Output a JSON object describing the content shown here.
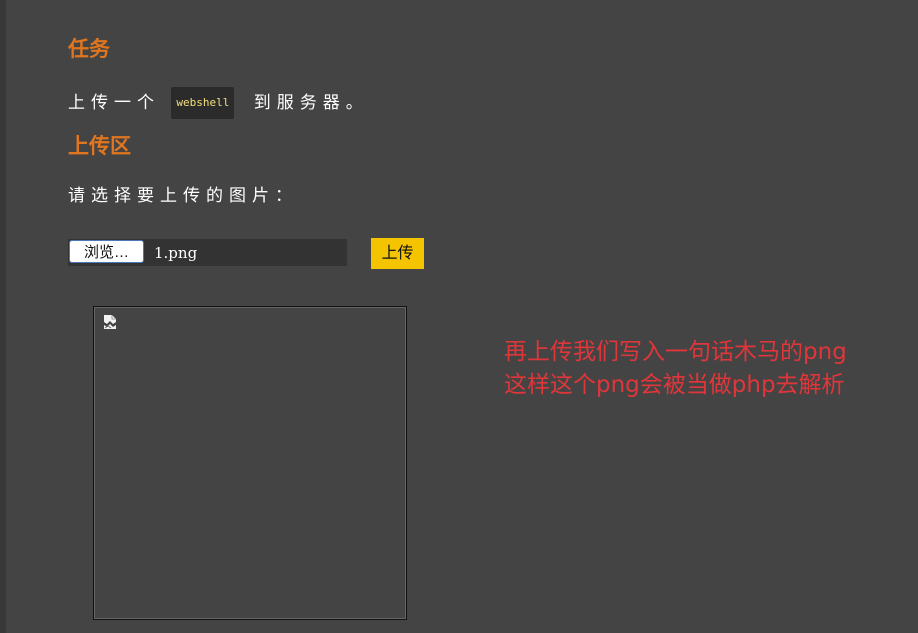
{
  "task": {
    "title": "任务",
    "text_before": "上传一个",
    "code": "webshell",
    "text_after": "到服务器。"
  },
  "upload": {
    "title": "上传区",
    "prompt": "请选择要上传的图片：",
    "browse_label": "浏览…",
    "file_name": "1.png",
    "submit_label": "上传"
  },
  "preview": {
    "icon": "broken-image-icon"
  },
  "annotation": {
    "line1": "再上传我们写入一句话木马的png",
    "line2": "这样这个png会被当做php去解析",
    "color": "#e0363a"
  },
  "colors": {
    "background": "#444444",
    "heading": "#e0761f",
    "button": "#f5c400"
  }
}
